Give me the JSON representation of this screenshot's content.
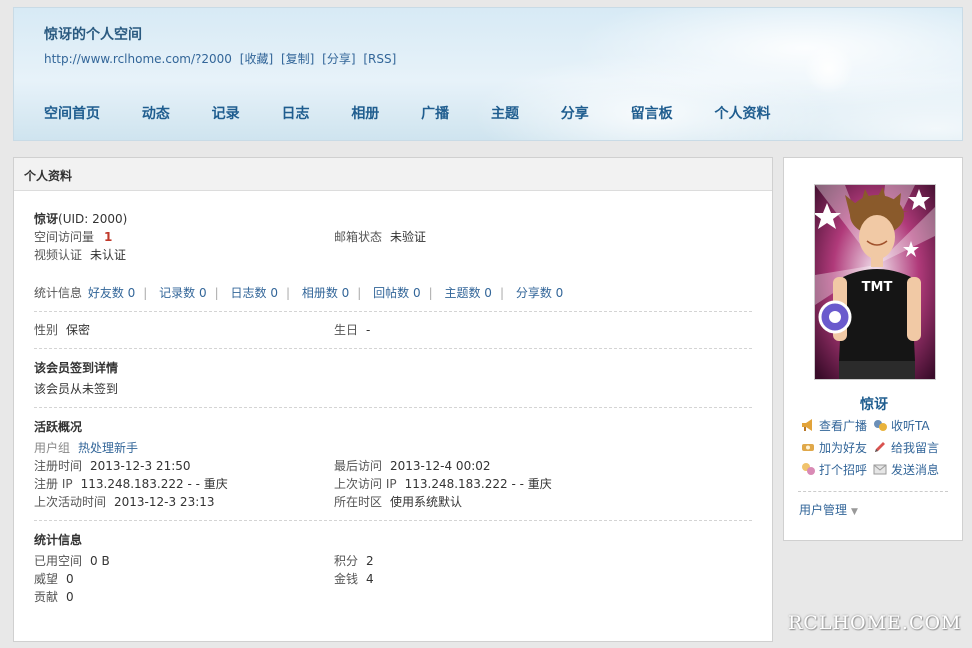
{
  "header": {
    "title": "惊讶的个人空间",
    "url": "http://www.rclhome.com/?2000",
    "url_links": [
      "[收藏]",
      "[复制]",
      "[分享]",
      "[RSS]"
    ],
    "nav": [
      "空间首页",
      "动态",
      "记录",
      "日志",
      "相册",
      "广播",
      "主题",
      "分享",
      "留言板",
      "个人资料"
    ]
  },
  "main": {
    "box_title": "个人资料",
    "username": "惊讶",
    "uid": "(UID: 2000)",
    "visits_label": "空间访问量",
    "visits_value": "1",
    "email_label": "邮箱状态",
    "email_value": "未验证",
    "video_label": "视频认证",
    "video_value": "未认证",
    "stats_label": "统计信息",
    "stats": [
      "好友数 0",
      "记录数 0",
      "日志数 0",
      "相册数 0",
      "回帖数 0",
      "主题数 0",
      "分享数 0"
    ],
    "gender_label": "性别",
    "gender_value": "保密",
    "birthday_label": "生日",
    "birthday_value": "-",
    "signin_title": "该会员签到详情",
    "signin_text": "该会员从未签到",
    "activity_title": "活跃概况",
    "usergroup_label": "用户组",
    "usergroup_value": "热处理新手",
    "reg_time_label": "注册时间",
    "reg_time_value": "2013-12-3 21:50",
    "last_visit_label": "最后访问",
    "last_visit_value": "2013-12-4 00:02",
    "reg_ip_label": "注册 IP",
    "reg_ip_value": "113.248.183.222 - - 重庆",
    "last_ip_label": "上次访问 IP",
    "last_ip_value": "113.248.183.222 - - 重庆",
    "last_active_label": "上次活动时间",
    "last_active_value": "2013-12-3 23:13",
    "timezone_label": "所在时区",
    "timezone_value": "使用系统默认",
    "stats_title": "统计信息",
    "space_label": "已用空间",
    "space_value": "0 B",
    "points_label": "积分",
    "points_value": "2",
    "prestige_label": "威望",
    "prestige_value": "0",
    "money_label": "金钱",
    "money_value": "4",
    "contrib_label": "贡献",
    "contrib_value": "0"
  },
  "sidebar": {
    "name": "惊讶",
    "avatar_text": "TMT",
    "actions": [
      "查看广播",
      "收听TA",
      "加为好友",
      "给我留言",
      "打个招呼",
      "发送消息"
    ],
    "user_manage": "用户管理",
    "icons": [
      "megaphone-icon",
      "listen-icon",
      "add-friend-icon",
      "message-pen-icon",
      "greet-icon",
      "mail-icon"
    ]
  },
  "watermark": "RCLHOME.COM",
  "colors": {
    "link": "#336699",
    "nav": "#1f5d8f",
    "highlight": "#c0392b"
  }
}
